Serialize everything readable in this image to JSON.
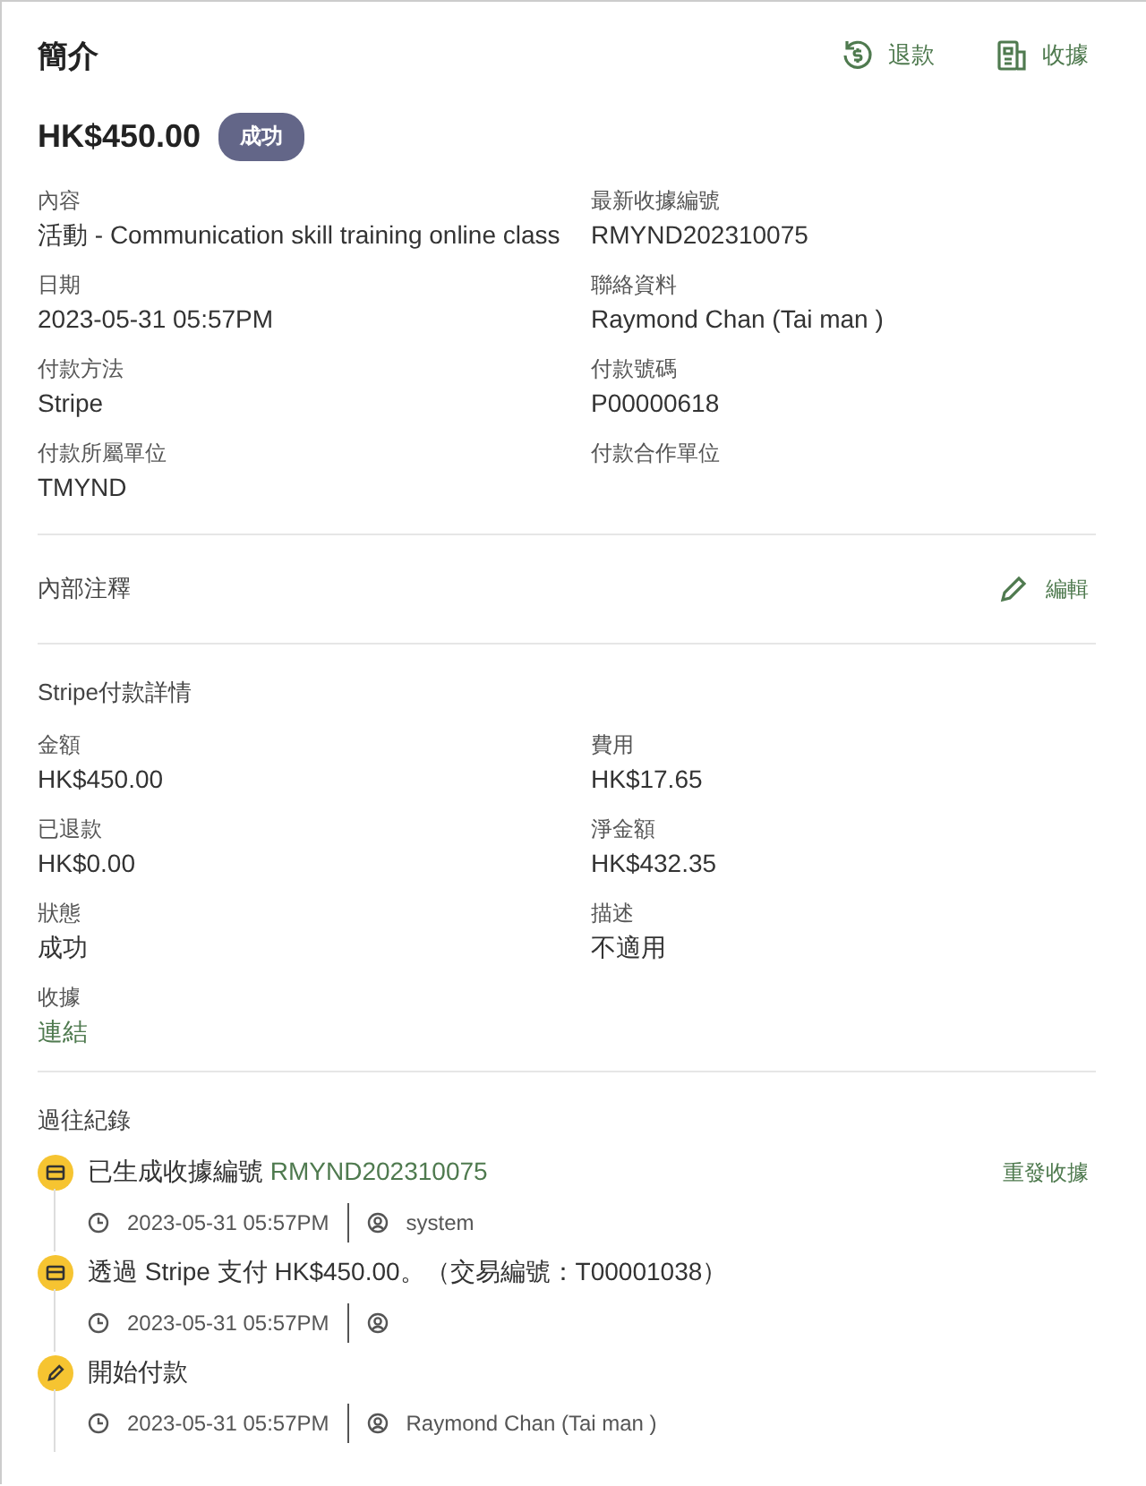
{
  "header": {
    "title": "簡介",
    "actions": [
      {
        "label": "退款",
        "kind": "refund"
      },
      {
        "label": "收據",
        "kind": "receipt"
      }
    ]
  },
  "amount": "HK$450.00",
  "status_badge": "成功",
  "info_fields": [
    {
      "label": "內容",
      "value": "活動 - Communication skill training online class"
    },
    {
      "label": "最新收據編號",
      "value": "RMYND202310075"
    },
    {
      "label": "日期",
      "value": "2023-05-31 05:57PM"
    },
    {
      "label": "聯絡資料",
      "value": "Raymond Chan (Tai man )"
    },
    {
      "label": "付款方法",
      "value": "Stripe"
    },
    {
      "label": "付款號碼",
      "value": "P00000618"
    },
    {
      "label": "付款所屬單位",
      "value": "TMYND"
    },
    {
      "label": "付款合作單位"
    }
  ],
  "internal_notes": {
    "title": "內部注釋",
    "edit": "編輯"
  },
  "stripe": {
    "title": "Stripe付款詳情",
    "fields": [
      {
        "label": "金額",
        "value": "HK$450.00",
        "kind": "text"
      },
      {
        "label": "費用",
        "value": "HK$17.65",
        "kind": "text"
      },
      {
        "label": "已退款",
        "value": "HK$0.00",
        "kind": "text"
      },
      {
        "label": "淨金額",
        "value": "HK$432.35",
        "kind": "text"
      },
      {
        "label": "狀態",
        "value": "成功",
        "kind": "text"
      },
      {
        "label": "描述",
        "value": "不適用",
        "kind": "text"
      },
      {
        "label": "收據",
        "value": "連結",
        "kind": "link"
      }
    ]
  },
  "history": {
    "title": "過往紀錄",
    "entries": [
      {
        "kind": "card",
        "text": "已生成收據編號",
        "ref": "RMYND202310075",
        "action": "重發收據",
        "time": "2023-05-31 05:57PM",
        "user": "system"
      },
      {
        "kind": "card",
        "text": "透過 Stripe 支付 HK$450.00。（交易編號：T00001038）",
        "time": "2023-05-31 05:57PM"
      },
      {
        "kind": "pencil",
        "text": "開始付款",
        "time": "2023-05-31 05:57PM",
        "user": "Raymond Chan (Tai man )"
      }
    ]
  }
}
